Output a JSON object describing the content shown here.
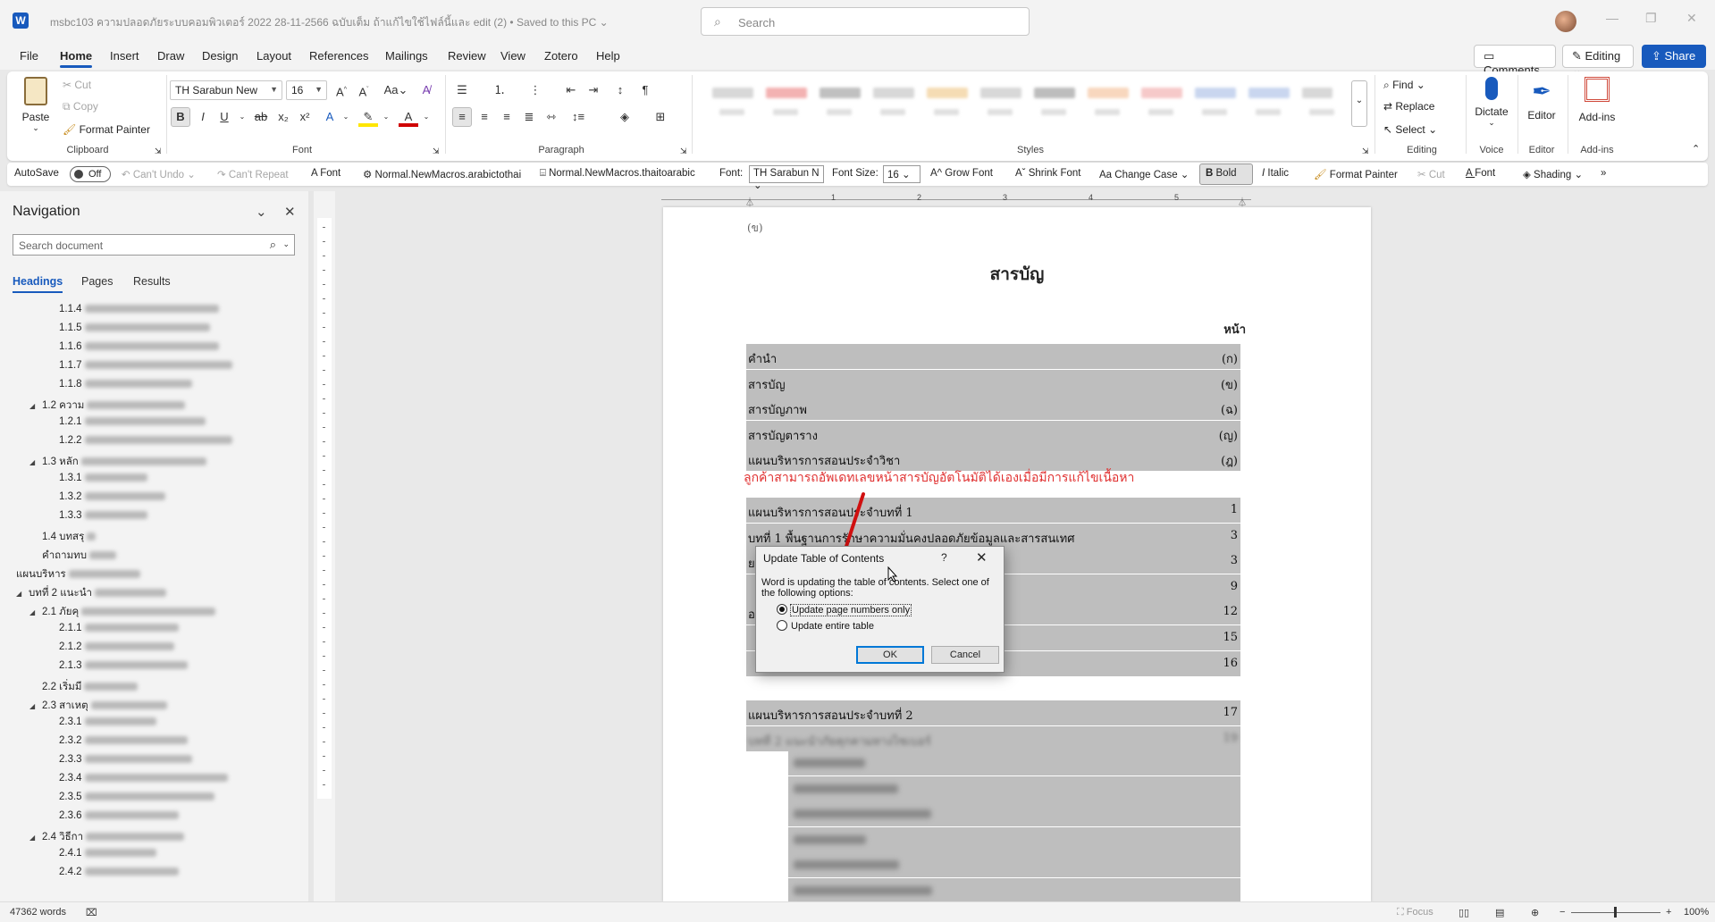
{
  "titlebar": {
    "app_icon": "W",
    "doc_title": "msbc103 ความปลอดภัยระบบคอมพิวเตอร์ 2022 28-11-2566 ฉบับเต็ม ถ้าแก้ไขใช้ไฟล์นี้และ edit (2)  •  Saved to this PC ⌄",
    "search_placeholder": "Search"
  },
  "menu": {
    "tabs": [
      "File",
      "Home",
      "Insert",
      "Draw",
      "Design",
      "Layout",
      "References",
      "Mailings",
      "Review",
      "View",
      "Zotero",
      "Help"
    ],
    "comments": "Comments",
    "editing": "Editing",
    "share": "Share"
  },
  "ribbon": {
    "clipboard": {
      "label": "Clipboard",
      "paste": "Paste",
      "cut": "Cut",
      "copy": "Copy",
      "format_painter": "Format Painter"
    },
    "font": {
      "label": "Font",
      "name": "TH Sarabun New",
      "size": "16"
    },
    "paragraph": {
      "label": "Paragraph"
    },
    "styles": {
      "label": "Styles"
    },
    "editing": {
      "label": "Editing",
      "find": "Find",
      "replace": "Replace",
      "select": "Select"
    },
    "voice": {
      "label": "Voice",
      "dictate": "Dictate"
    },
    "editor": {
      "label": "Editor",
      "editor": "Editor"
    },
    "addins": {
      "label": "Add-ins",
      "addins": "Add-ins"
    }
  },
  "qat": {
    "autosave": "AutoSave",
    "autosave_state": "Off",
    "cant_undo": "Can't Undo",
    "cant_repeat": "Can't Repeat",
    "font": "Font",
    "macro1": "Normal.NewMacros.arabictothai",
    "macro2": "Normal.NewMacros.thaitoarabic",
    "font_label": "Font:",
    "font_value": "TH Sarabun N",
    "size_label": "Font Size:",
    "size_value": "16",
    "grow_font": "Grow Font",
    "shrink_font": "Shrink Font",
    "change_case": "Change Case",
    "bold": "Bold",
    "italic": "Italic",
    "format_painter": "Format Painter",
    "cut": "Cut",
    "font2": "Font",
    "shading": "Shading"
  },
  "navigation": {
    "title": "Navigation",
    "search_placeholder": "Search document",
    "tabs": [
      "Headings",
      "Pages",
      "Results"
    ],
    "items": [
      {
        "num": "1.1.4"
      },
      {
        "num": "1.1.5"
      },
      {
        "num": "1.1.6"
      },
      {
        "num": "1.1.7"
      },
      {
        "num": "1.1.8"
      },
      {
        "num": "1.2 ความ"
      },
      {
        "num": "1.2.1"
      },
      {
        "num": "1.2.2"
      },
      {
        "num": "1.3 หลัก"
      },
      {
        "num": "1.3.1"
      },
      {
        "num": "1.3.2"
      },
      {
        "num": "1.3.3"
      },
      {
        "num": "1.4 บทสรุ"
      },
      {
        "num": "คำถามทบ"
      },
      {
        "num": "แผนบริหาร"
      },
      {
        "num": "บทที่ 2 แนะนำ"
      },
      {
        "num": "2.1 ภัยคุ"
      },
      {
        "num": "2.1.1"
      },
      {
        "num": "2.1.2"
      },
      {
        "num": "2.1.3"
      },
      {
        "num": "2.2 เริ่มมี"
      },
      {
        "num": "2.3 สาเหตุ"
      },
      {
        "num": "2.3.1"
      },
      {
        "num": "2.3.2"
      },
      {
        "num": "2.3.3"
      },
      {
        "num": "2.3.4"
      },
      {
        "num": "2.3.5"
      },
      {
        "num": "2.3.6"
      },
      {
        "num": "2.4 วิธีกา"
      },
      {
        "num": "2.4.1"
      },
      {
        "num": "2.4.2"
      }
    ]
  },
  "document": {
    "page_mark": "(ข)",
    "heading": "สารบัญ",
    "page_header": "หน้า",
    "toc": [
      {
        "title": "คำนำ",
        "page": "(ก)"
      },
      {
        "title": "สารบัญ",
        "page": "(ข)"
      },
      {
        "title": "สารบัญภาพ",
        "page": "(ฉ)"
      },
      {
        "title": "สารบัญตาราง",
        "page": "(ญ)"
      },
      {
        "title": "แผนบริหารการสอนประจำวิชา",
        "page": "(ฎ)"
      }
    ],
    "note": "ลูกค้าสามารถอัพเดทเลขหน้าสารบัญอัตโนมัติได้เองเมื่อมีการแก้ไขเนื้อหา",
    "toc2": [
      {
        "title": "แผนบริหารการสอนประจำบทที่ 1",
        "page": "1"
      },
      {
        "title": "บทที่ 1 พื้นฐานการรักษาความมั่นคงปลอดภัยข้อมูลและสารสนเทศ",
        "page": "3"
      },
      {
        "title": "ย",
        "page": "3"
      },
      {
        "title": "",
        "page": "9"
      },
      {
        "title": "อดภัยข้อมูล",
        "page": "12"
      },
      {
        "title": "",
        "page": "15"
      },
      {
        "title": "",
        "page": "16"
      }
    ],
    "toc3": [
      {
        "title": "แผนบริหารการสอนประจำบทที่ 2",
        "page": "17"
      },
      {
        "title": "บทที่ 2 แนะนำภัยคุกคามทางไซเบอร์",
        "page": "19"
      }
    ]
  },
  "dialog": {
    "title": "Update Table of Contents",
    "help": "?",
    "body": "Word is updating the table of contents.  Select one of the following options:",
    "option1": "Update page numbers only",
    "option2": "Update entire table",
    "ok": "OK",
    "cancel": "Cancel"
  },
  "status": {
    "words": "47362 words",
    "focus": "Focus",
    "zoom": "100%"
  }
}
